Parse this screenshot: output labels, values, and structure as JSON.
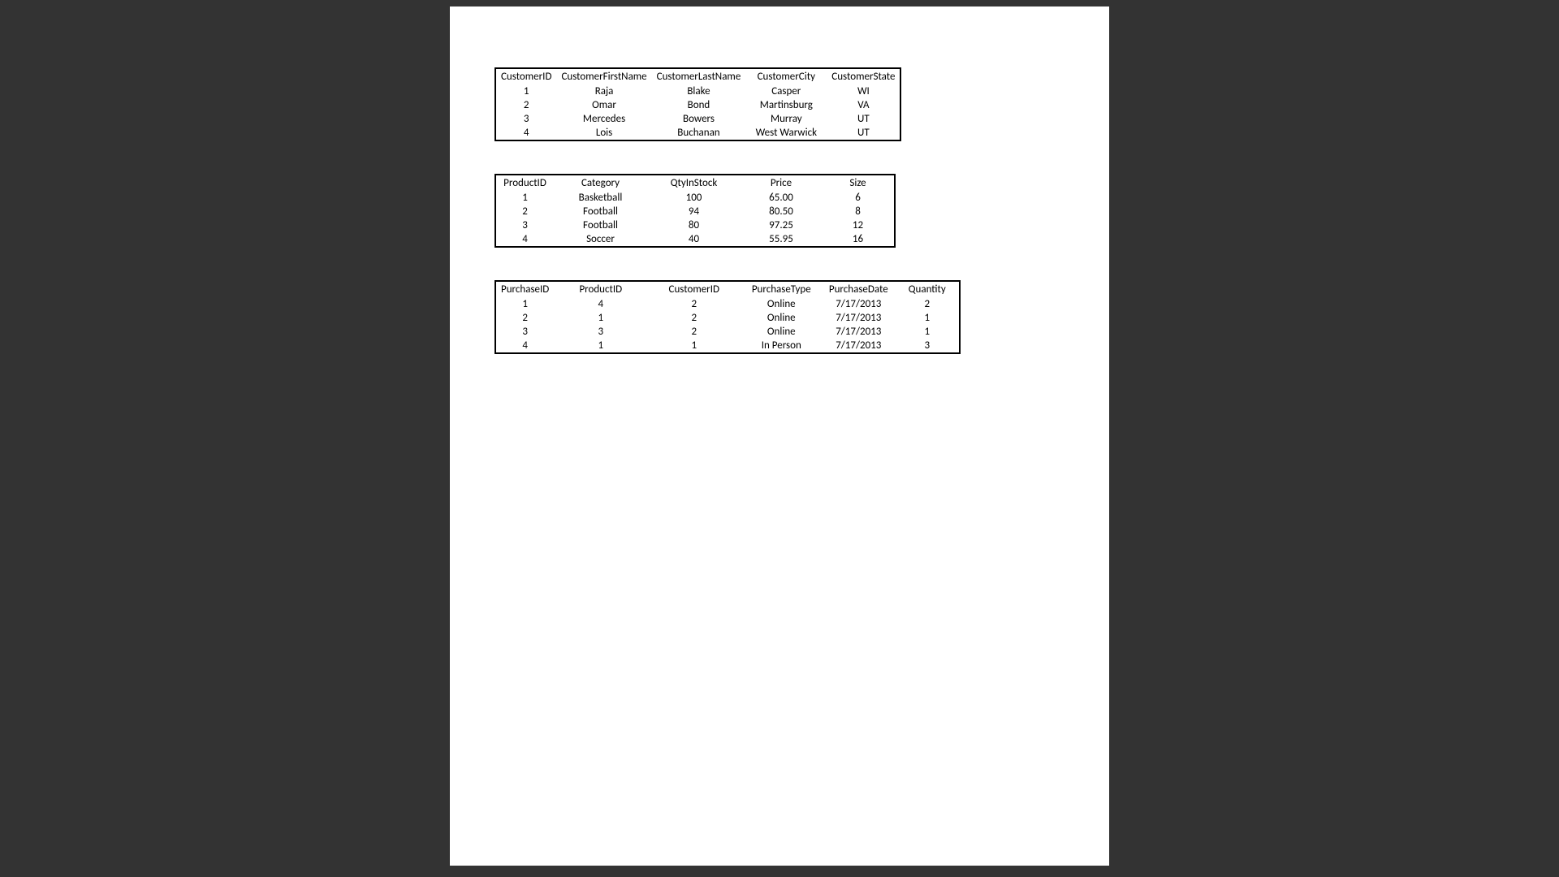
{
  "customers": {
    "headers": [
      "CustomerID",
      "CustomerFirstName",
      "CustomerLastName",
      "CustomerCity",
      "CustomerState"
    ],
    "rows": [
      [
        "1",
        "Raja",
        "Blake",
        "Casper",
        "WI"
      ],
      [
        "2",
        "Omar",
        "Bond",
        "Martinsburg",
        "VA"
      ],
      [
        "3",
        "Mercedes",
        "Bowers",
        "Murray",
        "UT"
      ],
      [
        "4",
        "Lois",
        "Buchanan",
        "West Warwick",
        "UT"
      ]
    ]
  },
  "products": {
    "headers": [
      "ProductID",
      "Category",
      "QtyInStock",
      "Price",
      "Size"
    ],
    "rows": [
      [
        "1",
        "Basketball",
        "100",
        "65.00",
        "6"
      ],
      [
        "2",
        "Football",
        "94",
        "80.50",
        "8"
      ],
      [
        "3",
        "Football",
        "80",
        "97.25",
        "12"
      ],
      [
        "4",
        "Soccer",
        "40",
        "55.95",
        "16"
      ]
    ]
  },
  "purchases": {
    "headers": [
      "PurchaseID",
      "ProductID",
      "CustomerID",
      "PurchaseType",
      "PurchaseDate",
      "Quantity"
    ],
    "rows": [
      [
        "1",
        "4",
        "2",
        "Online",
        "7/17/2013",
        "2"
      ],
      [
        "2",
        "1",
        "2",
        "Online",
        "7/17/2013",
        "1"
      ],
      [
        "3",
        "3",
        "2",
        "Online",
        "7/17/2013",
        "1"
      ],
      [
        "4",
        "1",
        "1",
        "In Person",
        "7/17/2013",
        "3"
      ]
    ]
  }
}
